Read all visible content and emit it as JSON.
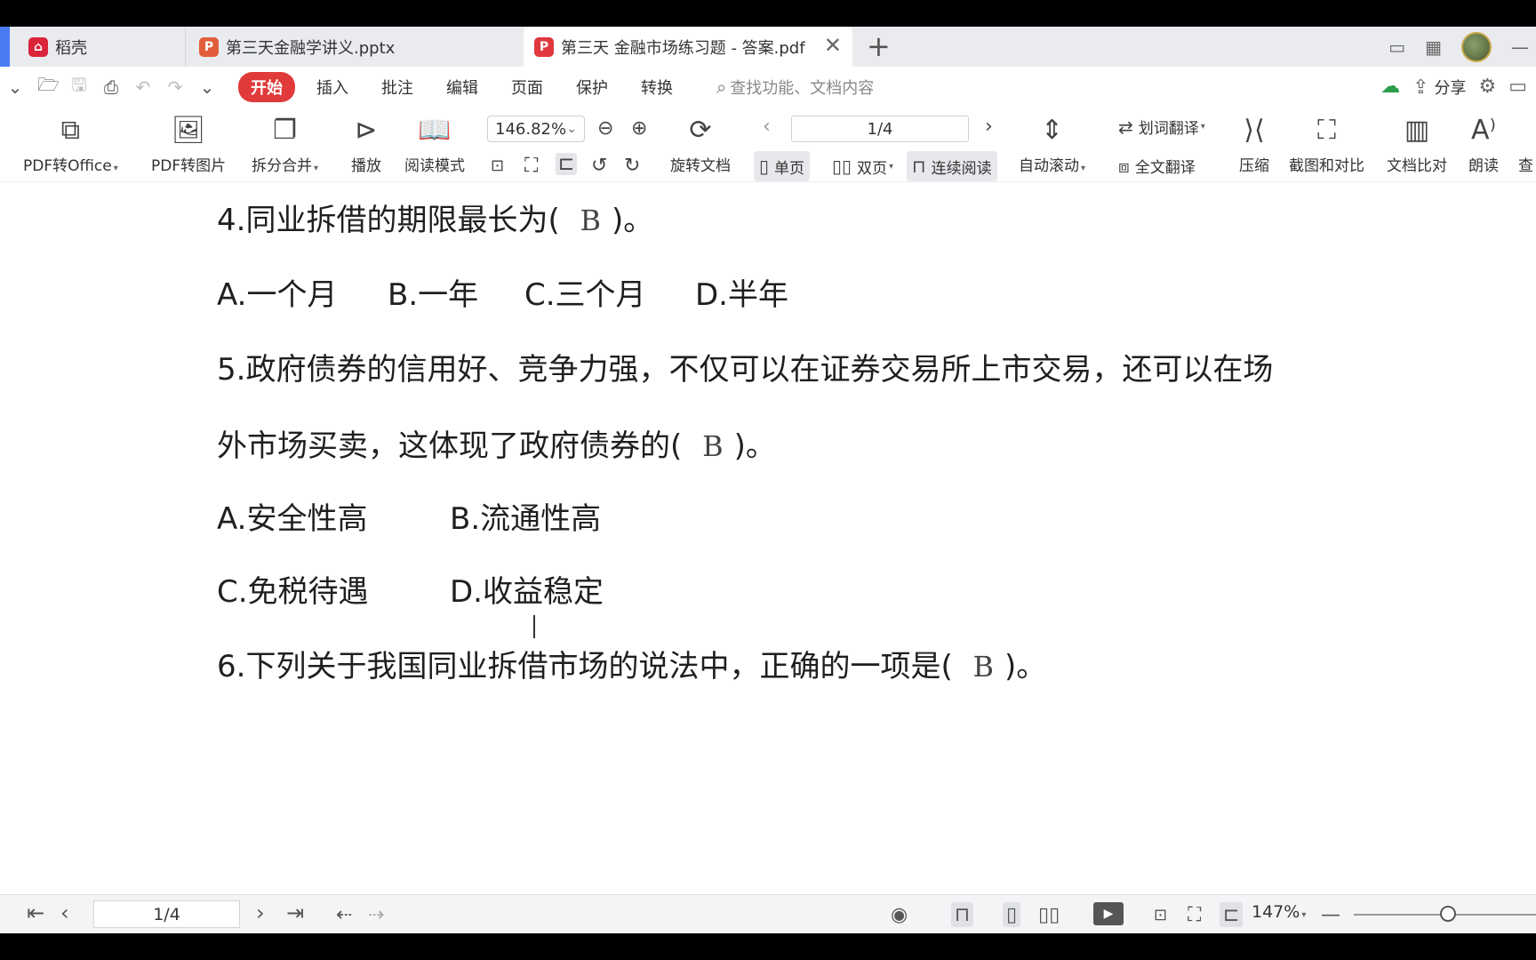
{
  "tabs": {
    "home": {
      "label": "稻壳"
    },
    "ppt": {
      "label": "第三天金融学讲义.pptx"
    },
    "pdf": {
      "label": "第三天 金融市场练习题 - 答案.pdf"
    },
    "close": "✕",
    "add": "+"
  },
  "menu": {
    "items": [
      "开始",
      "插入",
      "批注",
      "编辑",
      "页面",
      "保护",
      "转换"
    ],
    "search_placeholder": "查找功能、文档内容",
    "share": "分享"
  },
  "toolbar": {
    "pdf_to_office": "PDF转Office",
    "pdf_to_image": "PDF转图片",
    "split_merge": "拆分合并",
    "play": "播放",
    "read_mode": "阅读模式",
    "zoom": "146.82%",
    "rotate": "旋转文档",
    "page": "1/4",
    "single_page": "单页",
    "double_page": "双页",
    "continuous": "连续阅读",
    "auto_scroll": "自动滚动",
    "word_translate": "划词翻译",
    "full_translate": "全文翻译",
    "compress": "压缩",
    "screenshot_compare": "截图和对比",
    "doc_compare": "文档比对",
    "read_aloud": "朗读",
    "more": "查"
  },
  "document": {
    "q4": {
      "text": "4.同业拆借的期限最长为(",
      "answer": "B",
      "end": ")。"
    },
    "q4_options": [
      "A.一个月",
      "B.一年",
      "C.三个月",
      "D.半年"
    ],
    "q5_line1": "5.政府债券的信用好、竞争力强，不仅可以在证券交易所上市交易，还可以在场",
    "q5_line2": {
      "text": "外市场买卖，这体现了政府债券的(",
      "answer": "B",
      "end": ")。"
    },
    "q5_options_row1": [
      "A.安全性高",
      "B.流通性高"
    ],
    "q5_options_row2": [
      "C.免税待遇",
      "D.收益稳定"
    ],
    "q6": {
      "text": "6.下列关于我国同业拆借市场的说法中，正确的一项是(",
      "answer": "B",
      "end": ")。"
    }
  },
  "statusbar": {
    "page": "1/4",
    "zoom": "147%"
  }
}
